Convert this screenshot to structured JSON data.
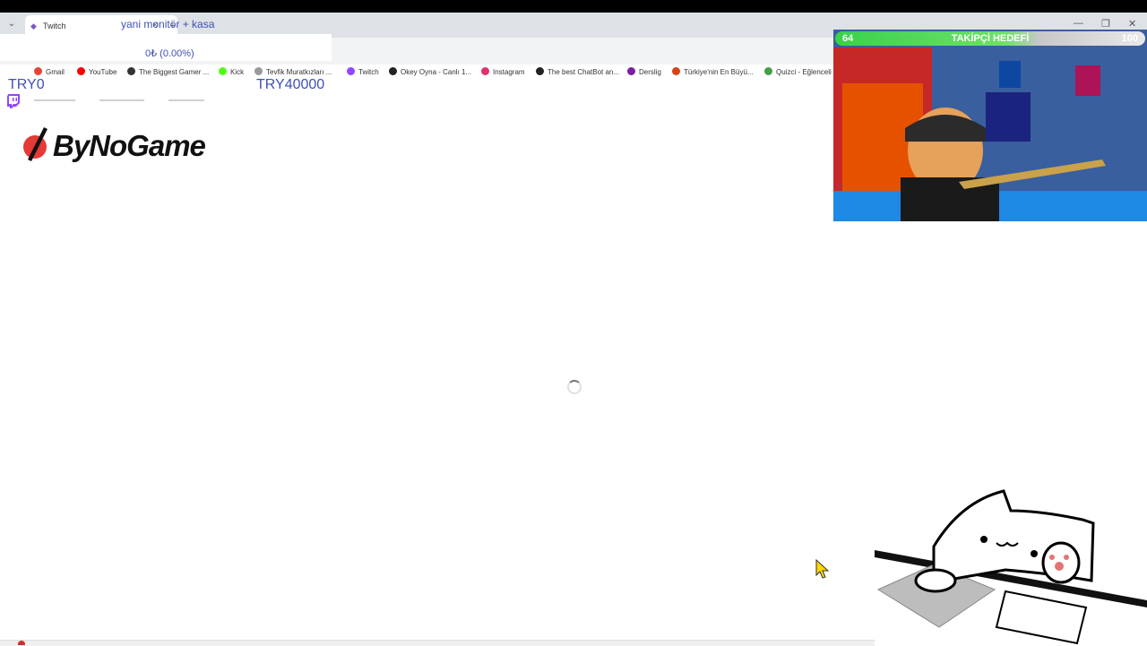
{
  "browser": {
    "tab_title": "Twitch",
    "bookmarks": [
      {
        "label": "Gmail",
        "icon": "gmail-icon",
        "color": "#ea4335"
      },
      {
        "label": "YouTube",
        "icon": "youtube-icon",
        "color": "#ff0000"
      },
      {
        "label": "The Biggest Gamer ...",
        "icon": "site-icon",
        "color": "#333333"
      },
      {
        "label": "Kick",
        "icon": "kick-icon",
        "color": "#53fc18"
      },
      {
        "label": "Tevfik Muratkızları ...",
        "icon": "site-icon",
        "color": "#999999"
      },
      {
        "label": "Twitch",
        "icon": "twitch-icon",
        "color": "#9146ff"
      },
      {
        "label": "Okey Oyna - Canlı 1...",
        "icon": "okey-icon",
        "color": "#222222"
      },
      {
        "label": "Instagram",
        "icon": "instagram-icon",
        "color": "#e1306c"
      },
      {
        "label": "The best ChatBot an...",
        "icon": "github-icon",
        "color": "#222222"
      },
      {
        "label": "Derslig",
        "icon": "derslig-icon",
        "color": "#7b1fa2"
      },
      {
        "label": "Türkiye'nin En Büyü...",
        "icon": "site-icon",
        "color": "#d84315"
      },
      {
        "label": "Quizci - Eğlenceli",
        "icon": "quiz-icon",
        "color": "#43a047"
      }
    ]
  },
  "donation_goal": {
    "title": "yani monitör + kasa",
    "current_amount": "0₺ (0.00%)",
    "min_label": "TRY0",
    "max_label": "TRY40000",
    "progress": 0
  },
  "sponsor": {
    "logo_text": "ByNoGame"
  },
  "follower_goal": {
    "current": "64",
    "title": "TAKİPÇİ HEDEFİ",
    "target": "100",
    "progress": 0.64
  }
}
